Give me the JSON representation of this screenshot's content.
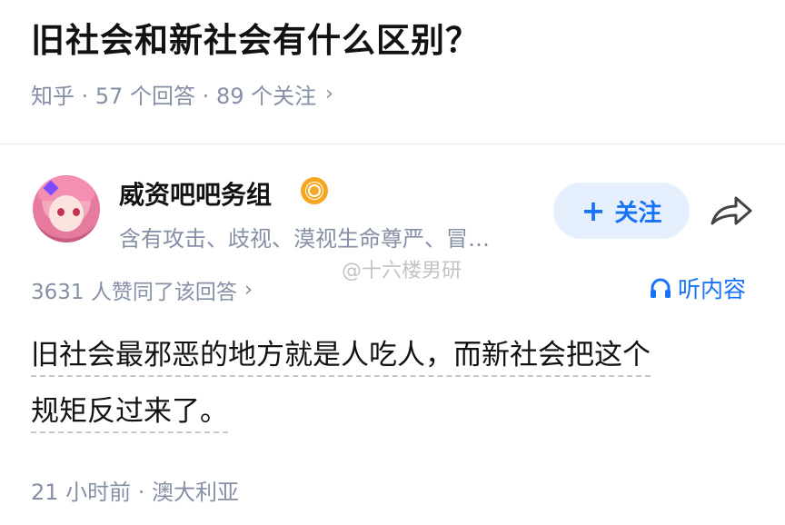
{
  "question": {
    "title": "旧社会和新社会有什么区别？",
    "meta": "知乎 · 57 个回答 · 89 个关注",
    "chevron": "›"
  },
  "author": {
    "name": "威资吧吧务组",
    "bio": "含有攻击、歧视、漠视生命尊严、冒…",
    "follow_label": "关注",
    "follow_plus": "+"
  },
  "answer": {
    "votes": "3631 人赞同了该回答",
    "votes_chevron": "›",
    "listen_label": "听内容",
    "text_line1": "旧社会最邪恶的地方就是人吃人，而新社会把这个",
    "text_line2": "规矩反过来了。",
    "footer": "21 小时前 · 澳大利亚"
  },
  "watermark": "@十六楼男研",
  "colors": {
    "accent": "#1772f6",
    "follow_bg": "#e5effe",
    "meta_text": "#8590a6",
    "badge": "#f5a623"
  },
  "icons": {
    "badge": "eye-badge-icon",
    "share": "share-arrow-icon",
    "listen": "headphones-icon"
  }
}
